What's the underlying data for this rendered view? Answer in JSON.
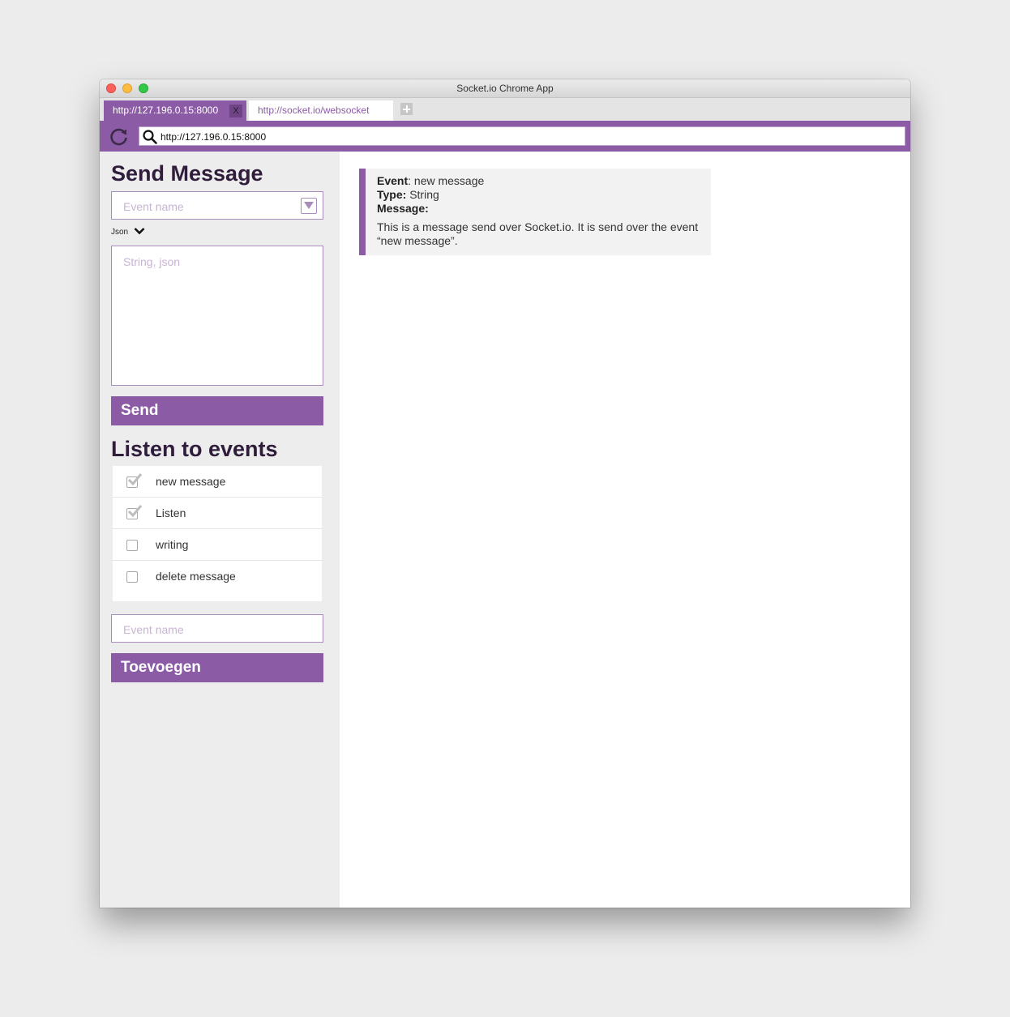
{
  "window": {
    "title": "Socket.io Chrome App"
  },
  "tabs": [
    {
      "label": "http://127.196.0.15:8000",
      "active": true,
      "close_label": "X"
    },
    {
      "label": "http://socket.io/websocket",
      "active": false
    }
  ],
  "toolbar": {
    "url": "http://127.196.0.15:8000"
  },
  "send_panel": {
    "heading": "Send Message",
    "event_placeholder": "Event name",
    "format_label": "Json",
    "message_placeholder": "String, json",
    "send_label": "Send"
  },
  "listen_panel": {
    "heading": "Listen to events",
    "events": [
      {
        "label": "new message",
        "checked": true
      },
      {
        "label": "Listen",
        "checked": true
      },
      {
        "label": "writing",
        "checked": false
      },
      {
        "label": "delete message",
        "checked": false
      }
    ],
    "new_event_placeholder": "Event name",
    "add_label": "Toevoegen"
  },
  "messages": [
    {
      "event_key": "Event",
      "event_value": ": new message",
      "type_key": "Type:",
      "type_value": " String",
      "message_key": "Message:",
      "body": "This is a message send over Socket.io. It is send over the event “new message”."
    }
  ],
  "colors": {
    "accent": "#8b5ba5",
    "heading": "#2f1d3b",
    "sidebar_bg": "#ededed"
  },
  "icons": [
    "reload-icon",
    "search-icon",
    "dropdown-arrow-icon",
    "chevron-down-icon",
    "checkbox-checked-icon",
    "checkbox-empty-icon",
    "plus-icon"
  ]
}
